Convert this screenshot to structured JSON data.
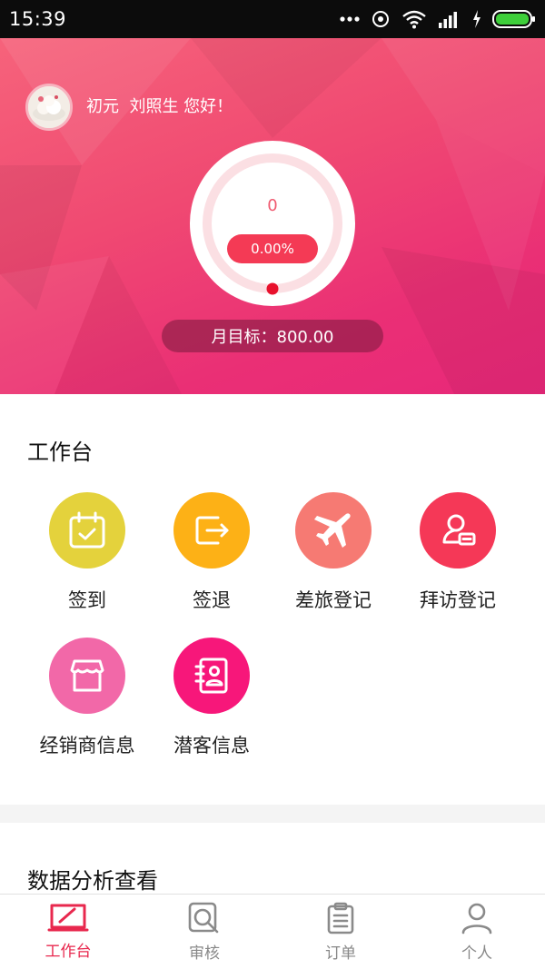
{
  "status_bar": {
    "time": "15:39"
  },
  "header": {
    "greeting": "初元  刘照生 您好！",
    "progress_value": "0",
    "progress_percent": "0.00%",
    "monthly_target": "月目标：800.00"
  },
  "workbench": {
    "title": "工作台",
    "items": [
      {
        "label": "签到",
        "icon": "calendar-check-icon",
        "color": "#e4d23c"
      },
      {
        "label": "签退",
        "icon": "logout-arrow-icon",
        "color": "#fdb116"
      },
      {
        "label": "差旅登记",
        "icon": "airplane-icon",
        "color": "#f67a73"
      },
      {
        "label": "拜访登记",
        "icon": "visitor-card-icon",
        "color": "#f53857"
      },
      {
        "label": "经销商信息",
        "icon": "store-icon",
        "color": "#f268a8"
      },
      {
        "label": "潜客信息",
        "icon": "contact-book-icon",
        "color": "#f7177a"
      }
    ]
  },
  "analysis": {
    "title": "数据分析查看"
  },
  "bottom_nav": {
    "items": [
      {
        "label": "工作台",
        "icon": "workbench-icon",
        "active": true
      },
      {
        "label": "审核",
        "icon": "review-icon",
        "active": false
      },
      {
        "label": "订单",
        "icon": "clipboard-icon",
        "active": false
      },
      {
        "label": "个人",
        "icon": "person-icon",
        "active": false
      }
    ]
  },
  "colors": {
    "accent": "#e8284e",
    "hero_start": "#f6637b",
    "hero_end": "#e8287a",
    "nav_inactive": "#888888"
  }
}
